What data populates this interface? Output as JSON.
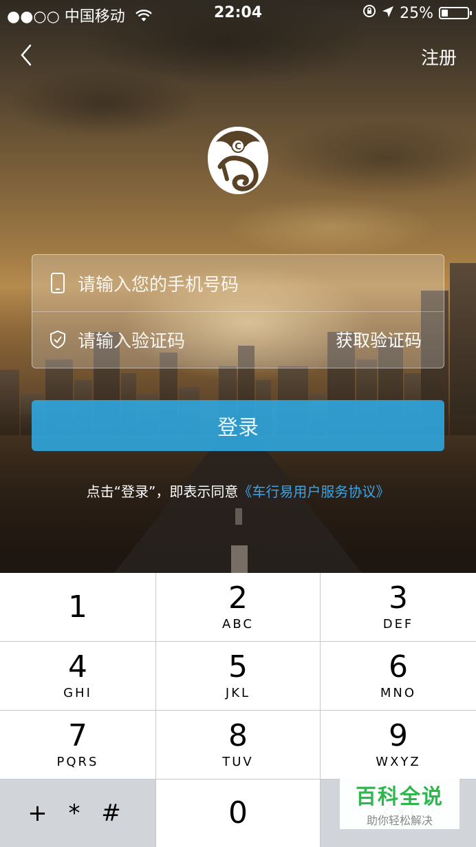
{
  "status_bar": {
    "carrier": "●●○○ 中国移动",
    "time": "22:04",
    "battery": "25%",
    "battery_level": 0.25
  },
  "nav": {
    "register_label": "注册"
  },
  "form": {
    "phone_placeholder": "请输入您的手机号码",
    "code_placeholder": "请输入验证码",
    "get_code_label": "获取验证码"
  },
  "login_button_label": "登录",
  "agreement": {
    "prefix": "点击“登录”，即表示同意",
    "link": "《车行易用户服务协议》"
  },
  "keypad": {
    "keys": [
      {
        "num": "1",
        "letters": ""
      },
      {
        "num": "2",
        "letters": "ABC"
      },
      {
        "num": "3",
        "letters": "DEF"
      },
      {
        "num": "4",
        "letters": "GHI"
      },
      {
        "num": "5",
        "letters": "JKL"
      },
      {
        "num": "6",
        "letters": "MNO"
      },
      {
        "num": "7",
        "letters": "PQRS"
      },
      {
        "num": "8",
        "letters": "TUV"
      },
      {
        "num": "9",
        "letters": "WXYZ"
      },
      {
        "num": "0",
        "letters": ""
      }
    ],
    "symbols_label": "+ * #"
  },
  "watermark": {
    "title": "百科全说",
    "subtitle": "助你轻松解决"
  },
  "colors": {
    "accent": "#2faae4",
    "link": "#38a6e8"
  }
}
